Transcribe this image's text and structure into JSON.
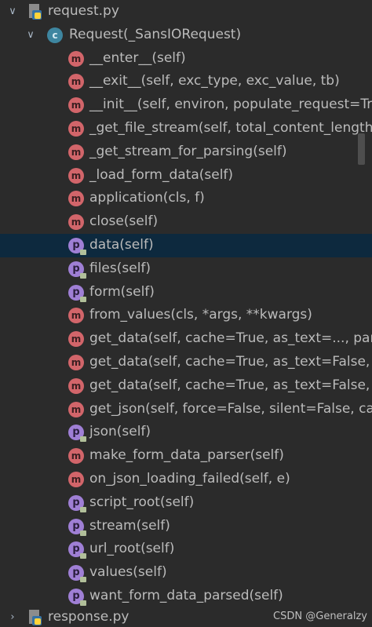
{
  "tree": {
    "file_request": "request.py",
    "class_label": "Request(_SansIORequest)",
    "members": [
      {
        "kind": "m",
        "text": "__enter__(self)"
      },
      {
        "kind": "m",
        "text": "__exit__(self, exc_type, exc_value, tb)"
      },
      {
        "kind": "m",
        "text": "__init__(self, environ, populate_request=Tr"
      },
      {
        "kind": "m",
        "text": "_get_file_stream(self, total_content_length"
      },
      {
        "kind": "m",
        "text": "_get_stream_for_parsing(self)"
      },
      {
        "kind": "m",
        "text": "_load_form_data(self)"
      },
      {
        "kind": "m",
        "text": "application(cls, f)"
      },
      {
        "kind": "m",
        "text": "close(self)"
      },
      {
        "kind": "p",
        "text": "data(self)"
      },
      {
        "kind": "p",
        "text": "files(self)"
      },
      {
        "kind": "p",
        "text": "form(self)"
      },
      {
        "kind": "m",
        "text": "from_values(cls, *args, **kwargs)"
      },
      {
        "kind": "m",
        "text": "get_data(self, cache=True, as_text=..., pars"
      },
      {
        "kind": "m",
        "text": "get_data(self, cache=True, as_text=False, p"
      },
      {
        "kind": "m",
        "text": "get_data(self, cache=True, as_text=False, p"
      },
      {
        "kind": "m",
        "text": "get_json(self, force=False, silent=False, ca"
      },
      {
        "kind": "p",
        "text": "json(self)"
      },
      {
        "kind": "m",
        "text": "make_form_data_parser(self)"
      },
      {
        "kind": "m",
        "text": "on_json_loading_failed(self, e)"
      },
      {
        "kind": "p",
        "text": "script_root(self)"
      },
      {
        "kind": "p",
        "text": "stream(self)"
      },
      {
        "kind": "p",
        "text": "url_root(self)"
      },
      {
        "kind": "p",
        "text": "values(self)"
      },
      {
        "kind": "p",
        "text": "want_form_data_parsed(self)"
      }
    ],
    "selected_member": "data(self)",
    "file_response": "response.py"
  },
  "icons": {
    "expanded": "chevron-down-icon",
    "collapsed": "chevron-right-icon",
    "method_letter": "m",
    "property_letter": "p",
    "class_letter": "c"
  },
  "colors": {
    "background": "#2b2b2b",
    "selection": "#0d293e",
    "method_icon": "#d2656a",
    "property_icon": "#9f7fd5",
    "class_icon": "#3e86a0"
  },
  "watermark": "CSDN @Generalzy"
}
